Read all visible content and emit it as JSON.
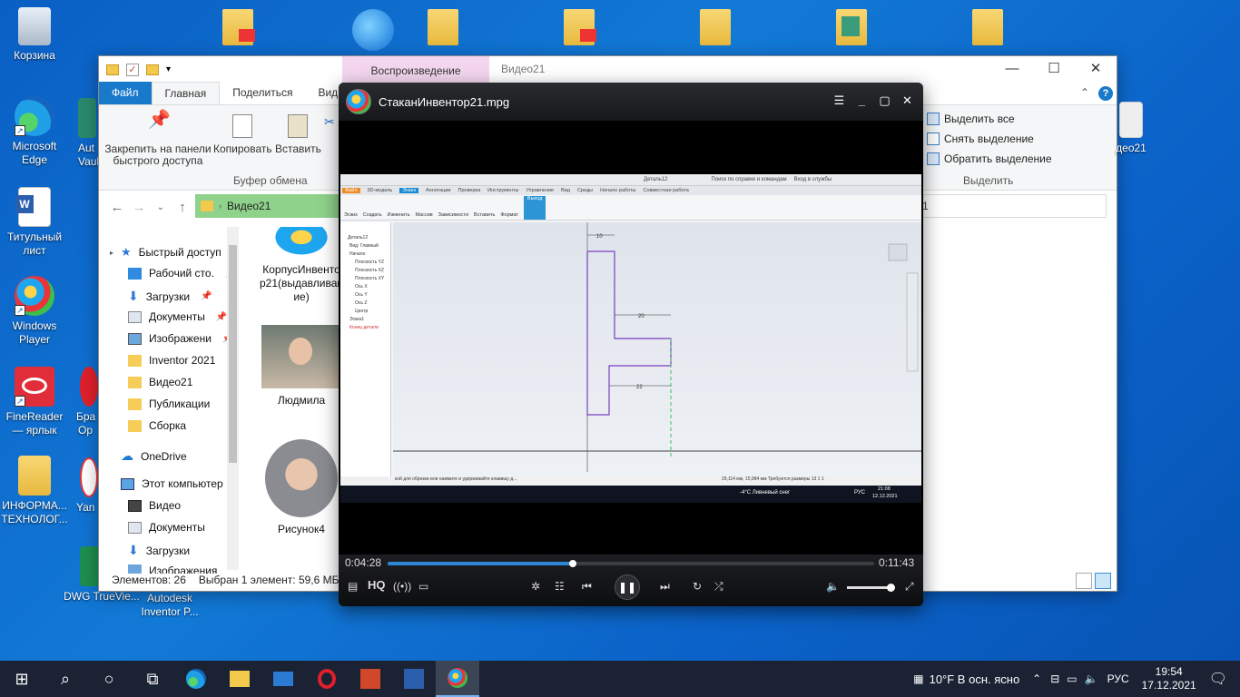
{
  "desktop": {
    "icons_left": [
      {
        "label": "Корзина",
        "icon": "recycle-bin-icon"
      },
      {
        "label": "Microsoft Edge",
        "icon": "edge-icon"
      },
      {
        "label": "Титульный лист",
        "icon": "word-doc-icon"
      },
      {
        "label": "Windows Player",
        "icon": "windows-player-icon"
      },
      {
        "label": "FineReader — ярлык",
        "icon": "finereader-icon"
      },
      {
        "label": "ИНФОРМА... ТЕХНОЛОГ...",
        "icon": "pdf-folder-icon"
      },
      {
        "label": "DWG TrueVie...",
        "icon": "dwg-icon"
      }
    ],
    "icons_col2": [
      {
        "label": "Aut Vaul",
        "icon": "autodesk-vault-icon"
      },
      {
        "label": "Бра Op",
        "icon": "opera-browser-icon"
      },
      {
        "label": "Yan",
        "icon": "yandex-icon"
      },
      {
        "label": "Autodesk Inventor P...",
        "icon": "inventor-icon"
      }
    ],
    "right_icon_label": "део21"
  },
  "explorer": {
    "context_tab": "Воспроизведение",
    "title": "Видео21",
    "tabs": [
      "Файл",
      "Главная",
      "Поделиться",
      "Вид"
    ],
    "ribbon": {
      "pin_label": "Закрепить на панели быстрого доступа",
      "copy_label": "Копировать",
      "paste_label": "Вставить",
      "group_clipboard": "Буфер обмена",
      "select_all": "Выделить все",
      "select_none": "Снять выделение",
      "invert_selection": "Обратить выделение",
      "group_select": "Выделить"
    },
    "address": "Видео21",
    "search_fragment": "1",
    "nav": [
      {
        "label": "Быстрый доступ",
        "icon": "star-icon",
        "pin": false
      },
      {
        "label": "Рабочий сто.",
        "icon": "desktop-icon",
        "pin": true
      },
      {
        "label": "Загрузки",
        "icon": "download-icon",
        "pin": true
      },
      {
        "label": "Документы",
        "icon": "documents-icon",
        "pin": true
      },
      {
        "label": "Изображени",
        "icon": "pictures-icon",
        "pin": true
      },
      {
        "label": "Inventor 2021",
        "icon": "folder-icon",
        "pin": false
      },
      {
        "label": "Видео21",
        "icon": "folder-icon",
        "pin": false
      },
      {
        "label": "Публикации",
        "icon": "folder-icon",
        "pin": false
      },
      {
        "label": "Сборка",
        "icon": "folder-icon",
        "pin": false
      },
      {
        "label": "OneDrive",
        "icon": "cloud-icon",
        "pin": false
      },
      {
        "label": "Этот компьютер",
        "icon": "computer-icon",
        "pin": false
      },
      {
        "label": "Видео",
        "icon": "video-icon",
        "pin": false
      },
      {
        "label": "Документы",
        "icon": "documents-icon",
        "pin": false
      },
      {
        "label": "Загрузки",
        "icon": "download-icon",
        "pin": false
      },
      {
        "label": "Изображения",
        "icon": "pictures-icon",
        "pin": false
      }
    ],
    "files": [
      {
        "label": "КорпусИнвенто р21(выдавливан ие)"
      },
      {
        "label": "Людмила"
      },
      {
        "label": "Рисунок4"
      }
    ],
    "status_count": "Элементов: 26",
    "status_selected": "Выбран 1 элемент: 59,6 МБ"
  },
  "player": {
    "title": "СтаканИнвентор21.mpg",
    "time_current": "0:04:28",
    "time_total": "0:11:43",
    "progress": 0.38,
    "hq_label": "HQ",
    "volume": 0.95,
    "video": {
      "app_title": "Деталь12",
      "search_hint": "Поиск по справке и командам",
      "login": "Вход в службы",
      "tabs": [
        "Файл",
        "3D-модель",
        "Эскиз",
        "Аннотации",
        "Проверка",
        "Инструменты",
        "Управление",
        "Вид",
        "Среды",
        "Начало работы",
        "Совместная работа"
      ],
      "ribbon_buttons": [
        "Эскиз",
        "Создать",
        "Изменить",
        "Массив",
        "Зависимости",
        "Вставить",
        "Формат",
        "Выход"
      ],
      "browser": [
        "Деталь12",
        "Вид: Главный",
        "Начало",
        "Плоскость YZ",
        "Плоскость XZ",
        "Плоскость XY",
        "Ось X",
        "Ось Y",
        "Ось Z",
        "Центр",
        "Эскиз1",
        "Конец детали"
      ],
      "dims": [
        "10",
        "20",
        "22"
      ],
      "status_left": "кой для обрезки или нажмите и удерживайте клавишу д...",
      "status_right": "29,114 мм, 15,984 мм   Требуются размеры 13   1   1",
      "mini_weather": "-4°C  Ливневый снег",
      "mini_lang": "РУС",
      "mini_time": "21:08",
      "mini_date": "12.12.2021"
    }
  },
  "taskbar": {
    "apps": [
      "start-icon",
      "search-icon",
      "cortana-icon",
      "task-view-icon",
      "edge-icon",
      "explorer-icon",
      "mail-icon",
      "opera-icon",
      "powerpoint-icon",
      "word-icon",
      "windows-player-icon"
    ],
    "weather": "10°F  В осн. ясно",
    "lang": "РУС",
    "time": "19:54",
    "date": "17.12.2021"
  }
}
